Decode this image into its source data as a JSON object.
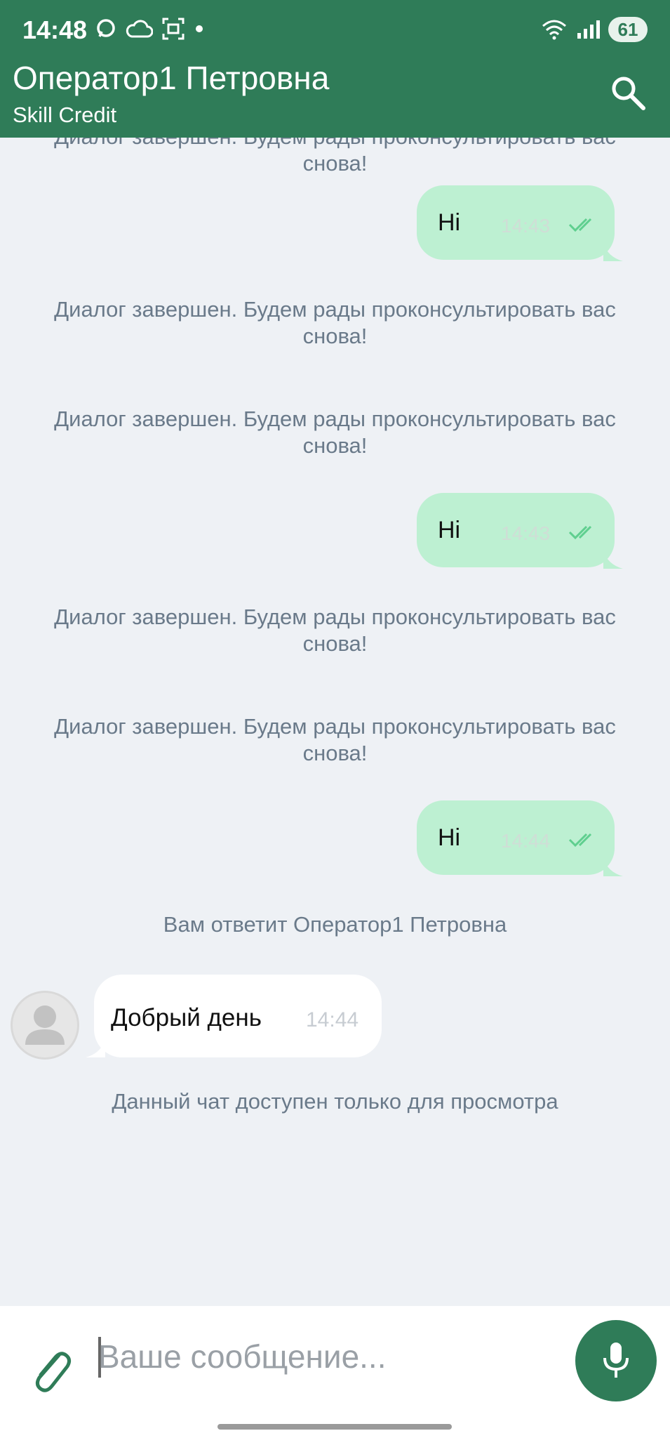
{
  "status_bar": {
    "time": "14:48",
    "battery": "61",
    "icons": [
      "chat-bubble-icon",
      "cloud-icon",
      "screenshot-icon",
      "dot-icon",
      "wifi-icon",
      "signal-icon",
      "battery-icon"
    ]
  },
  "header": {
    "title": "Оператор1 Петровна",
    "subtitle": "Skill Credit",
    "search_icon": "search-icon"
  },
  "messages": {
    "sys_0": "Диалог завершен. Будем рады проконсультировать вас снова!",
    "out_1": {
      "text": "Hi",
      "time": "14:43"
    },
    "sys_2": "Диалог завершен. Будем рады проконсультировать вас снова!",
    "sys_3": "Диалог завершен. Будем рады проконсультировать вас снова!",
    "out_4": {
      "text": "Hi",
      "time": "14:43"
    },
    "sys_5": "Диалог завершен. Будем рады проконсультировать вас снова!",
    "sys_6": "Диалог завершен. Будем рады проконсультировать вас снова!",
    "out_7": {
      "text": "Hi",
      "time": "14:44"
    },
    "sys_8": "Вам ответит Оператор1 Петровна",
    "in_9": {
      "text": "Добрый день",
      "time": "14:44"
    },
    "sys_10": "Данный чат доступен только для просмотра"
  },
  "composer": {
    "placeholder": "Ваше сообщение...",
    "value": ""
  },
  "colors": {
    "header": "#2f7c58",
    "outgoing_bubble": "#bdf0d2",
    "background": "#eef1f5",
    "system_text": "#6a7a8a"
  }
}
